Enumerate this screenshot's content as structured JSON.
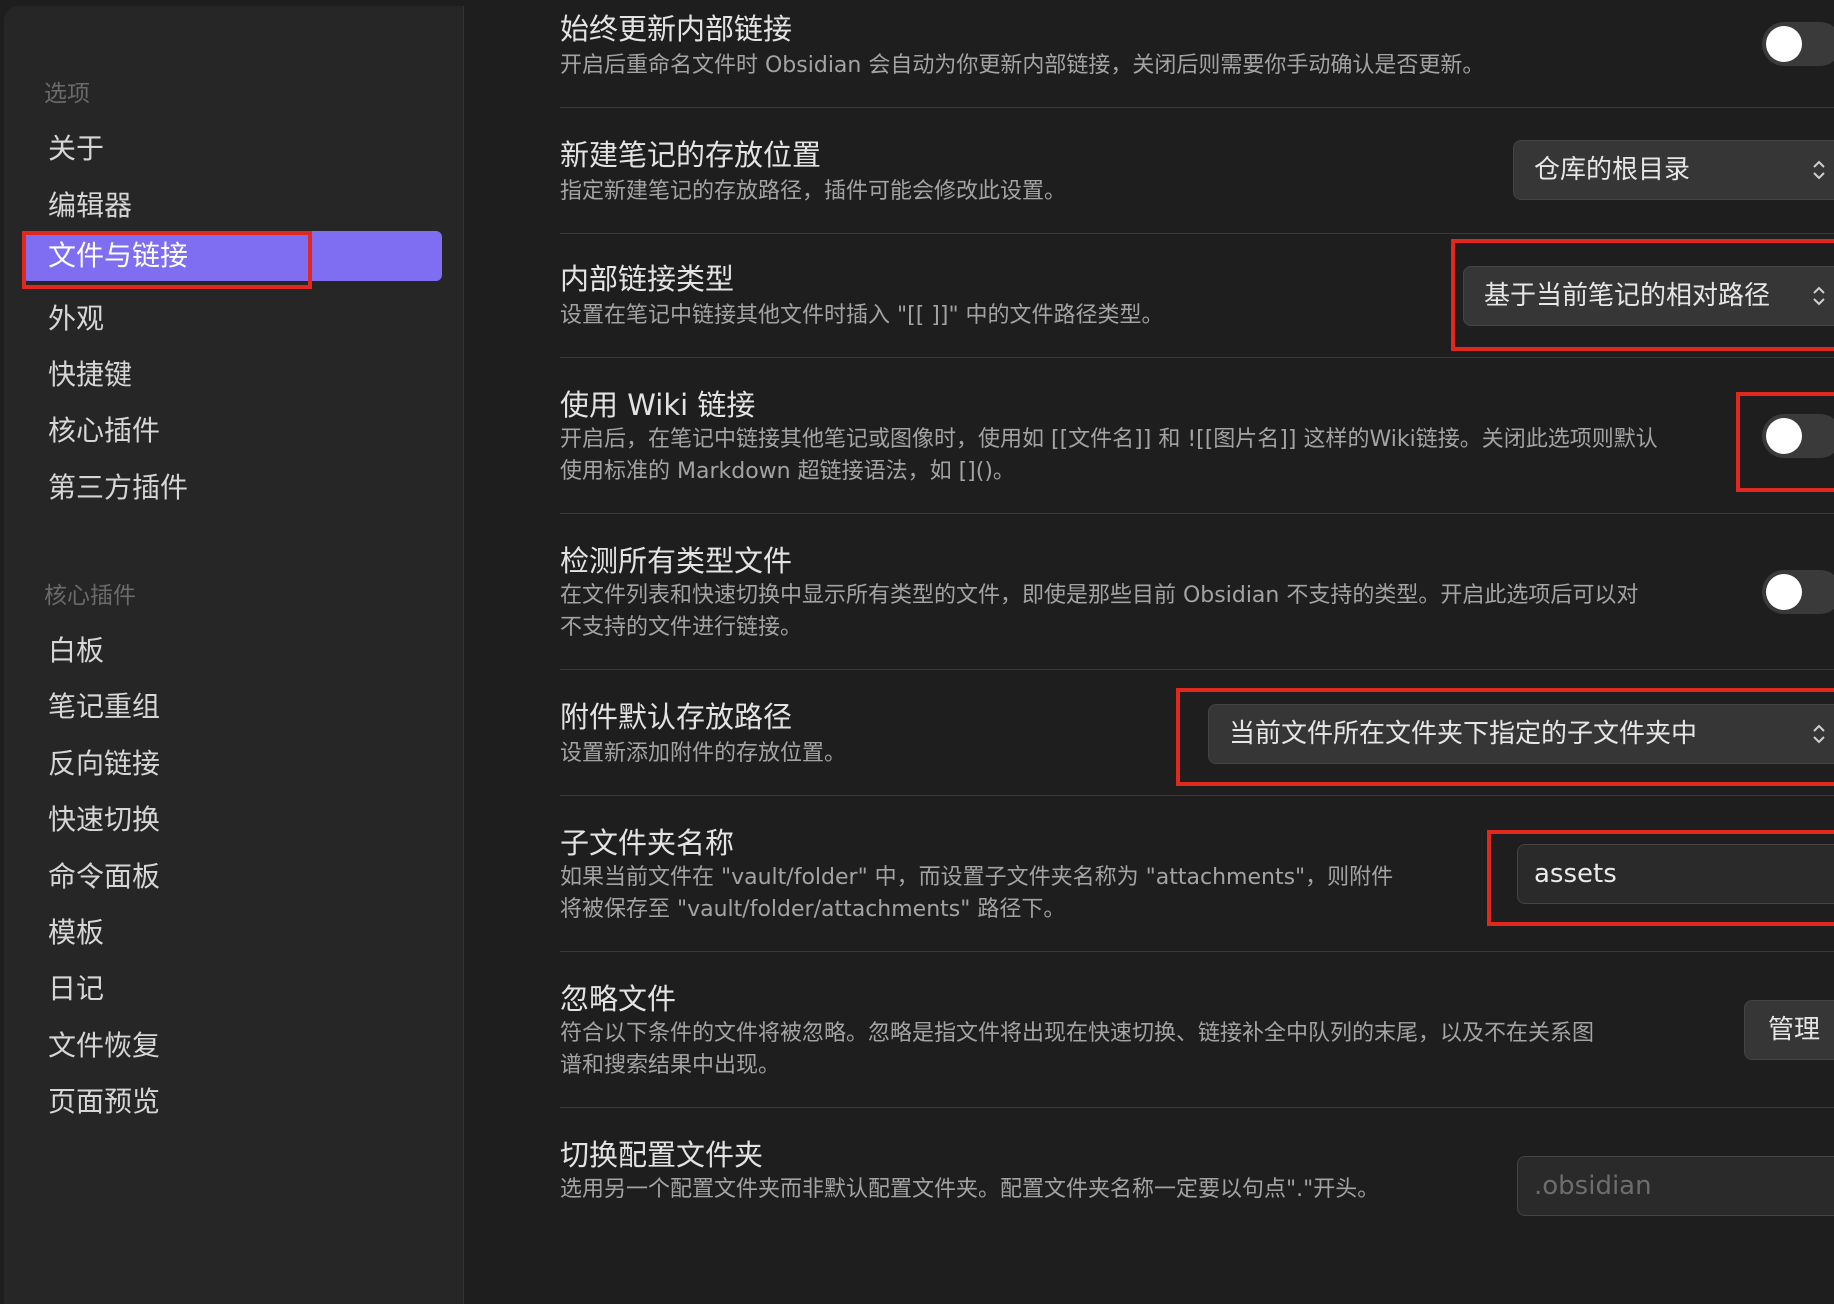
{
  "sidebar": {
    "options_title": "选项",
    "options": [
      {
        "label": "关于"
      },
      {
        "label": "编辑器"
      },
      {
        "label": "文件与链接"
      },
      {
        "label": "外观"
      },
      {
        "label": "快捷键"
      },
      {
        "label": "核心插件"
      },
      {
        "label": "第三方插件"
      }
    ],
    "core_title": "核心插件",
    "core_plugins": [
      {
        "label": "白板"
      },
      {
        "label": "笔记重组"
      },
      {
        "label": "反向链接"
      },
      {
        "label": "快速切换"
      },
      {
        "label": "命令面板"
      },
      {
        "label": "模板"
      },
      {
        "label": "日记"
      },
      {
        "label": "文件恢复"
      },
      {
        "label": "页面预览"
      }
    ]
  },
  "settings": {
    "auto_update_links": {
      "name": "始终更新内部链接",
      "desc": "开启后重命名文件时 Obsidian 会自动为你更新内部链接，关闭后则需要你手动确认是否更新。",
      "enabled": false
    },
    "new_note_location": {
      "name": "新建笔记的存放位置",
      "desc": "指定新建笔记的存放路径，插件可能会修改此设置。",
      "value": "仓库的根目录"
    },
    "link_format": {
      "name": "内部链接类型",
      "desc": "设置在笔记中链接其他文件时插入 \"[[ ]]\" 中的文件路径类型。",
      "value": "基于当前笔记的相对路径"
    },
    "wiki_links": {
      "name": "使用 Wiki 链接",
      "desc": "开启后，在笔记中链接其他笔记或图像时，使用如 [[文件名]] 和 ![[图片名]] 这样的Wiki链接。关闭此选项则默认使用标准的 Markdown 超链接语法，如 []()。",
      "enabled": false
    },
    "detect_all_files": {
      "name": "检测所有类型文件",
      "desc": "在文件列表和快速切换中显示所有类型的文件，即使是那些目前 Obsidian 不支持的类型。开启此选项后可以对不支持的文件进行链接。",
      "enabled": false
    },
    "attachment_location": {
      "name": "附件默认存放路径",
      "desc": "设置新添加附件的存放位置。",
      "value": "当前文件所在文件夹下指定的子文件夹中"
    },
    "subfolder_name": {
      "name": "子文件夹名称",
      "desc": "如果当前文件在 \"vault/folder\" 中，而设置子文件夹名称为 \"attachments\"，则附件将被保存至 \"vault/folder/attachments\" 路径下。",
      "value": "assets"
    },
    "ignore_files": {
      "name": "忽略文件",
      "desc": "符合以下条件的文件将被忽略。忽略是指文件将出现在快速切换、链接补全中队列的末尾，以及不在关系图谱和搜索结果中出现。",
      "button": "管理"
    },
    "config_folder": {
      "name": "切换配置文件夹",
      "desc": "选用另一个配置文件夹而非默认配置文件夹。配置文件夹名称一定要以句点\".\"开头。",
      "placeholder": ".obsidian"
    }
  },
  "colors": {
    "accent": "#7f6df2",
    "highlight": "#e0281f",
    "background": "#1e1e1e",
    "sidebar": "#262626"
  }
}
